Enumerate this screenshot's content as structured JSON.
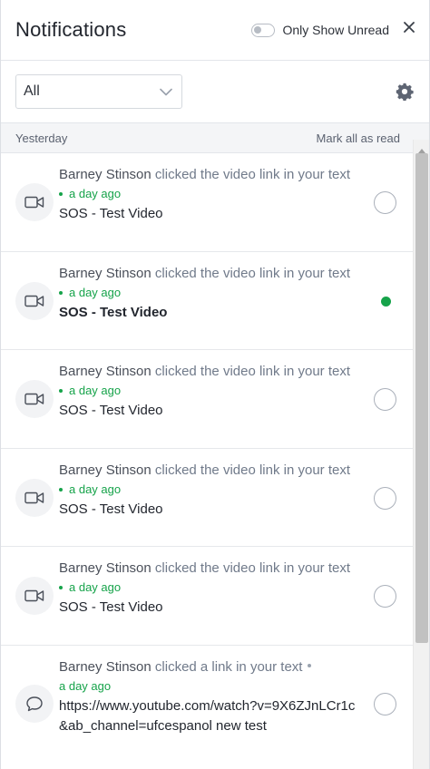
{
  "header": {
    "title": "Notifications",
    "unread_toggle_label": "Only Show Unread",
    "unread_toggle_on": false
  },
  "filter": {
    "selected": "All"
  },
  "section": {
    "label": "Yesterday",
    "mark_all": "Mark all as read"
  },
  "notifications": [
    {
      "actor": "Barney Stinson",
      "action": " clicked the video link in your text",
      "time": "a day ago",
      "subject": "SOS - Test Video",
      "icon": "video-camera-icon",
      "unread": false
    },
    {
      "actor": "Barney Stinson",
      "action": " clicked the video link in your text",
      "time": "a day ago",
      "subject": "SOS - Test Video",
      "icon": "video-camera-icon",
      "unread": true
    },
    {
      "actor": "Barney Stinson",
      "action": " clicked the video link in your text",
      "time": "a day ago",
      "subject": "SOS - Test Video",
      "icon": "video-camera-icon",
      "unread": false
    },
    {
      "actor": "Barney Stinson",
      "action": " clicked the video link in your text",
      "time": "a day ago",
      "subject": "SOS - Test Video",
      "icon": "video-camera-icon",
      "unread": false
    },
    {
      "actor": "Barney Stinson",
      "action": " clicked the video link in your text",
      "time": "a day ago",
      "subject": "SOS - Test Video",
      "icon": "video-camera-icon",
      "unread": false
    },
    {
      "actor": "Barney Stinson",
      "action": " clicked a link in your text",
      "time": "a day ago",
      "subject": "https://www.youtube.com/watch?v=9X6ZJnLCr1c&ab_channel=ufcespanol new test",
      "icon": "chat-bubble-icon",
      "unread": false
    }
  ],
  "colors": {
    "accent_green": "#16a34a",
    "muted_text": "#707a8a"
  }
}
